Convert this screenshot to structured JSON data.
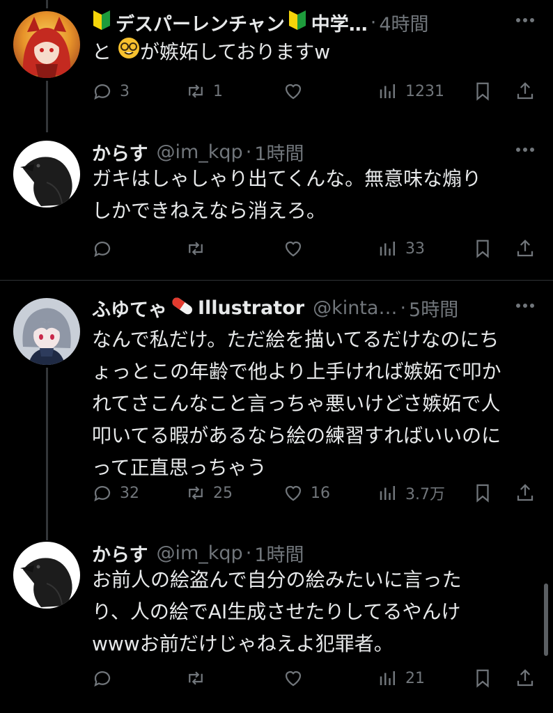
{
  "tweets": [
    {
      "name": "デスパーレンチャン",
      "name_suffix": "中学…",
      "handle": "",
      "time": "4時間",
      "lines": [
        "が嫉妬しておりますw"
      ],
      "line_prefix": "と",
      "avatar_icon": "red-haired-character-avatar",
      "reply_count": "3",
      "retweet_count": "1",
      "like_count": "",
      "view_count": "1231"
    },
    {
      "name": "からす",
      "handle": "@im_kqp",
      "time": "1時間",
      "lines": [
        "ガキはしゃしゃり出てくんな。無意味な煽り",
        "しかできねえなら消えろ。"
      ],
      "avatar_icon": "crow-avatar",
      "reply_count": "",
      "retweet_count": "",
      "like_count": "",
      "view_count": "33"
    },
    {
      "name": "ふゆてゃ",
      "name_suffix": "Illustrator",
      "handle": "@kinta…",
      "time": "5時間",
      "lines": [
        "なんで私だけ。ただ絵を描いてるだけなのにち",
        "ょっとこの年齢で他より上手ければ嫉妬で叩か",
        "れてさこんなこと言っちゃ悪いけどさ嫉妬で人",
        "叩いてる暇があるなら絵の練習すればいいのに",
        "って正直思っちゃう"
      ],
      "avatar_icon": "anime-girl-avatar",
      "reply_count": "32",
      "retweet_count": "25",
      "like_count": "16",
      "view_count": "3.7万"
    },
    {
      "name": "からす",
      "handle": "@im_kqp",
      "time": "1時間",
      "lines": [
        "お前人の絵盗んで自分の絵みたいに言った",
        "り、人の絵でAI生成させたりしてるやんけ",
        "wwwお前だけじゃねえよ犯罪者。"
      ],
      "avatar_icon": "crow-avatar",
      "reply_count": "",
      "retweet_count": "",
      "like_count": "",
      "view_count": "21"
    }
  ],
  "dot_separator": "·",
  "colors": {
    "background": "#000000",
    "text": "#e7e9ea",
    "secondary": "#71767b",
    "divider": "#2f3336",
    "beginner_green": "#1e9c3c",
    "beginner_yellow": "#f5d50a"
  }
}
